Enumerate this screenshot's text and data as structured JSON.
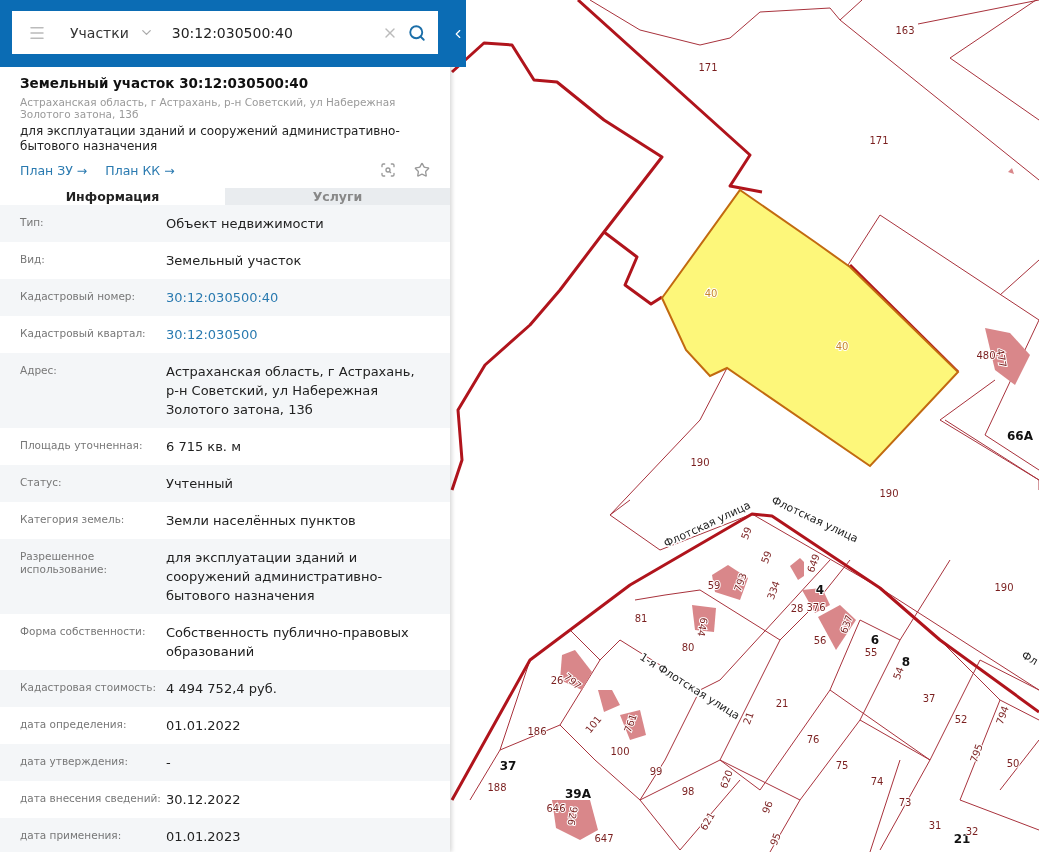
{
  "search": {
    "layer": "Участки",
    "value": "30:12:030500:40"
  },
  "card": {
    "title": "Земельный участок 30:12:030500:40",
    "address": "Астраханская область, г Астрахань, р-н Советский, ул Набережная Золотого затона, 13б",
    "purpose": "для эксплуатации зданий и сооружений административно-бытового назначения",
    "links": [
      "План ЗУ →",
      "План КК →"
    ]
  },
  "tabs": [
    {
      "label": "Информация",
      "selected": true
    },
    {
      "label": "Услуги",
      "selected": false
    }
  ],
  "rows": [
    {
      "label": "Тип:",
      "value": "Объект недвижимости",
      "kind": "text"
    },
    {
      "label": "Вид:",
      "value": "Земельный участок",
      "kind": "text"
    },
    {
      "label": "Кадастровый номер:",
      "value": "30:12:030500:40",
      "kind": "link"
    },
    {
      "label": "Кадастровый квартал:",
      "value": "30:12:030500",
      "kind": "link"
    },
    {
      "label": "Адрес:",
      "value": "Астраханская область, г Астрахань, р-н Советский, ул Набережная Золотого затона, 13б",
      "kind": "text"
    },
    {
      "label": "Площадь уточненная:",
      "value": "6 715 кв. м",
      "kind": "text"
    },
    {
      "label": "Статус:",
      "value": "Учтенный",
      "kind": "text"
    },
    {
      "label": "Категория земель:",
      "value": "Земли населённых пунктов",
      "kind": "text"
    },
    {
      "label": "Разрешенное использование:",
      "value": "для эксплуатации зданий и сооружений административно-бытового назначения",
      "kind": "text"
    },
    {
      "label": "Форма собственности:",
      "value": "Собственность публично-правовых образований",
      "kind": "text"
    },
    {
      "label": "Кадастровая стоимость:",
      "value": "4 494 752,4 руб.",
      "kind": "text"
    },
    {
      "label": "дата определения:",
      "value": "01.01.2022",
      "kind": "text"
    },
    {
      "label": "дата утверждения:",
      "value": "-",
      "kind": "text"
    },
    {
      "label": "дата внесения сведений:",
      "value": "30.12.2022",
      "kind": "text"
    },
    {
      "label": "дата применения:",
      "value": "01.01.2023",
      "kind": "text"
    }
  ],
  "map": {
    "labels": [
      {
        "text": "163",
        "kind": "number"
      },
      {
        "text": "171",
        "kind": "number"
      },
      {
        "text": "171",
        "kind": "number"
      },
      {
        "text": "40",
        "kind": "selected"
      },
      {
        "text": "40",
        "kind": "selected"
      },
      {
        "text": "480",
        "kind": "number"
      },
      {
        "text": "477",
        "kind": "number"
      },
      {
        "text": "66А",
        "kind": "house"
      },
      {
        "text": "190",
        "kind": "number"
      },
      {
        "text": "190",
        "kind": "number"
      },
      {
        "text": "Флотская улица",
        "kind": "street"
      },
      {
        "text": "Флотская улица",
        "kind": "street"
      },
      {
        "text": "59",
        "kind": "number"
      },
      {
        "text": "59",
        "kind": "number"
      },
      {
        "text": "649",
        "kind": "number"
      },
      {
        "text": "59",
        "kind": "number"
      },
      {
        "text": "793",
        "kind": "number"
      },
      {
        "text": "334",
        "kind": "number"
      },
      {
        "text": "4",
        "kind": "house"
      },
      {
        "text": "190",
        "kind": "number"
      },
      {
        "text": "28",
        "kind": "number"
      },
      {
        "text": "376",
        "kind": "number"
      },
      {
        "text": "81",
        "kind": "number"
      },
      {
        "text": "644",
        "kind": "number"
      },
      {
        "text": "637",
        "kind": "number"
      },
      {
        "text": "56",
        "kind": "number"
      },
      {
        "text": "6",
        "kind": "house"
      },
      {
        "text": "55",
        "kind": "number"
      },
      {
        "text": "8",
        "kind": "house"
      },
      {
        "text": "54",
        "kind": "number"
      },
      {
        "text": "80",
        "kind": "number"
      },
      {
        "text": "1-я Флотская улица",
        "kind": "street"
      },
      {
        "text": "26",
        "kind": "number"
      },
      {
        "text": "797",
        "kind": "number"
      },
      {
        "text": "21",
        "kind": "number"
      },
      {
        "text": "21",
        "kind": "number"
      },
      {
        "text": "37",
        "kind": "number"
      },
      {
        "text": "52",
        "kind": "number"
      },
      {
        "text": "794",
        "kind": "number"
      },
      {
        "text": "186",
        "kind": "number"
      },
      {
        "text": "101",
        "kind": "number"
      },
      {
        "text": "761",
        "kind": "number"
      },
      {
        "text": "100",
        "kind": "number"
      },
      {
        "text": "76",
        "kind": "number"
      },
      {
        "text": "37",
        "kind": "house"
      },
      {
        "text": "99",
        "kind": "number"
      },
      {
        "text": "75",
        "kind": "number"
      },
      {
        "text": "795",
        "kind": "number"
      },
      {
        "text": "50",
        "kind": "number"
      },
      {
        "text": "188",
        "kind": "number"
      },
      {
        "text": "74",
        "kind": "number"
      },
      {
        "text": "39А",
        "kind": "house"
      },
      {
        "text": "98",
        "kind": "number"
      },
      {
        "text": "620",
        "kind": "number"
      },
      {
        "text": "646",
        "kind": "number"
      },
      {
        "text": "926",
        "kind": "number"
      },
      {
        "text": "73",
        "kind": "number"
      },
      {
        "text": "31",
        "kind": "number"
      },
      {
        "text": "96",
        "kind": "number"
      },
      {
        "text": "621",
        "kind": "number"
      },
      {
        "text": "647",
        "kind": "number"
      },
      {
        "text": "95",
        "kind": "number"
      },
      {
        "text": "21",
        "kind": "house"
      },
      {
        "text": "32",
        "kind": "number"
      },
      {
        "text": "Фл",
        "kind": "street"
      }
    ]
  }
}
